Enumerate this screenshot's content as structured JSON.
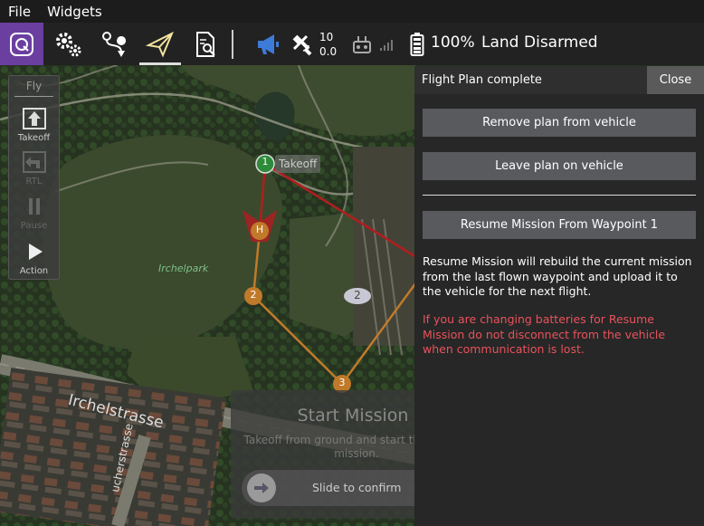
{
  "menu": {
    "file": "File",
    "widgets": "Widgets"
  },
  "toolbar": {
    "logo_icon": "qgc-logo-icon",
    "buttons": [
      "settings-gears-icon",
      "plan-route-icon",
      "fly-paper-plane-icon",
      "analyze-doc-icon"
    ],
    "selected_view": "fly",
    "satellites": {
      "count": "10",
      "hdop": "0.0"
    },
    "battery": "100%",
    "flight_mode": "Land",
    "arm_state": "Disarmed"
  },
  "map": {
    "park_label": "Irchelpark",
    "street_label": "Irchelstrasse",
    "street_label_2": "ucherstrasse",
    "waypoints": [
      {
        "label": "1",
        "text": "Takeoff"
      },
      {
        "label": "H"
      },
      {
        "label": "2"
      },
      {
        "label": "3"
      },
      {
        "label": "2"
      }
    ]
  },
  "fly_tools": {
    "title": "Fly",
    "items": [
      {
        "label": "Takeoff",
        "enabled": true
      },
      {
        "label": "RTL",
        "enabled": false
      },
      {
        "label": "Pause",
        "enabled": false
      },
      {
        "label": "Action",
        "enabled": true
      }
    ]
  },
  "panel": {
    "title": "Flight Plan complete",
    "close": "Close",
    "remove_btn": "Remove plan from vehicle",
    "leave_btn": "Leave plan on vehicle",
    "resume_btn": "Resume Mission From Waypoint 1",
    "resume_text": "Resume Mission will rebuild the current mission from the last flown waypoint and upload it to the vehicle for the next flight.",
    "warning_text": "If you are changing batteries for Resume Mission do not disconnect from the vehicle when communication is lost."
  },
  "start_mission": {
    "title": "Start Mission",
    "subtitle": "Takeoff from ground and start the current mission.",
    "slider_label": "Slide to confirm"
  },
  "colors": {
    "accent": "#6a3fa0",
    "warning": "#e9525b",
    "waypoint": "#c07a2a",
    "takeoff": "#2e8b3a",
    "route_red": "#b01e1e"
  }
}
